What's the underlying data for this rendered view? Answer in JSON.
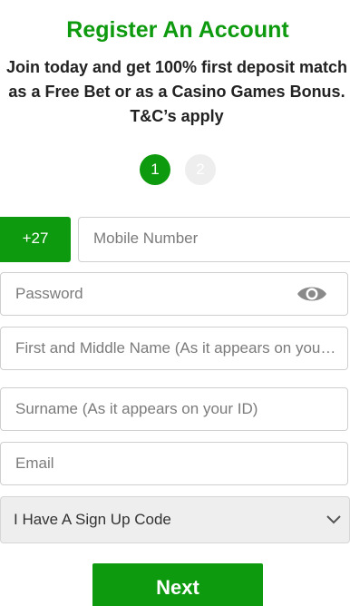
{
  "header": {
    "title": "Register An Account",
    "subtitle": "Join today and get 100% first deposit match as a Free Bet or as a Casino Games Bonus. T&C’s apply"
  },
  "steps": {
    "items": [
      "1",
      "2"
    ],
    "active": 1
  },
  "form": {
    "country_code": "+27",
    "mobile_placeholder": "Mobile Number",
    "password_placeholder": "Password",
    "first_name_placeholder": "First and Middle Name (As it appears on your ID)",
    "surname_placeholder": "Surname (As it appears on your ID)",
    "email_placeholder": "Email",
    "signup_code_select": "I Have A Sign Up Code"
  },
  "actions": {
    "next_label": "Next"
  },
  "icons": {
    "password_toggle": "eye-icon",
    "select_arrow": "chevron-down-icon"
  },
  "colors": {
    "brand_green": "#0e9a0e",
    "inactive_step": "#eeeeee"
  }
}
